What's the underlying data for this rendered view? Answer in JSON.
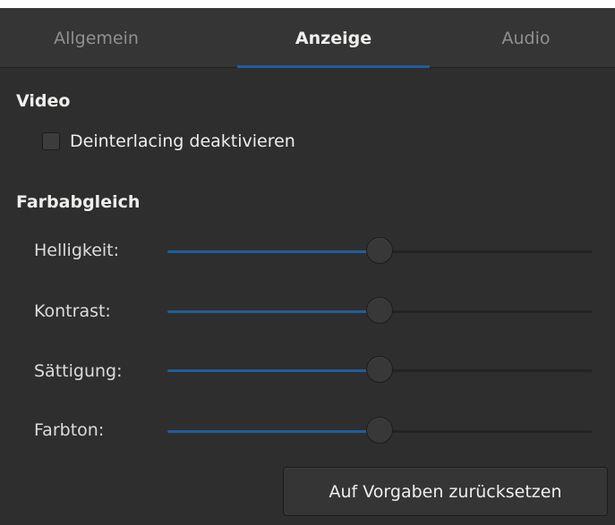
{
  "tabs": [
    {
      "label": "Allgemein",
      "active": false
    },
    {
      "label": "Anzeige",
      "active": true
    },
    {
      "label": "Audio",
      "active": false
    }
  ],
  "video": {
    "title": "Video",
    "deinterlace_label": "Deinterlacing deaktivieren",
    "deinterlace_checked": false
  },
  "color_balance": {
    "title": "Farbabgleich",
    "sliders": [
      {
        "label": "Helligkeit:",
        "value": 0.5
      },
      {
        "label": "Kontrast:",
        "value": 0.5
      },
      {
        "label": "Sättigung:",
        "value": 0.5
      },
      {
        "label": "Farbton:",
        "value": 0.5
      }
    ]
  },
  "reset_label": "Auf Vorgaben zurücksetzen",
  "colors": {
    "background": "#2e2e2e",
    "accent": "#215d9c",
    "text": "#eeeeec",
    "inactive_tab_text": "#8e918f"
  }
}
